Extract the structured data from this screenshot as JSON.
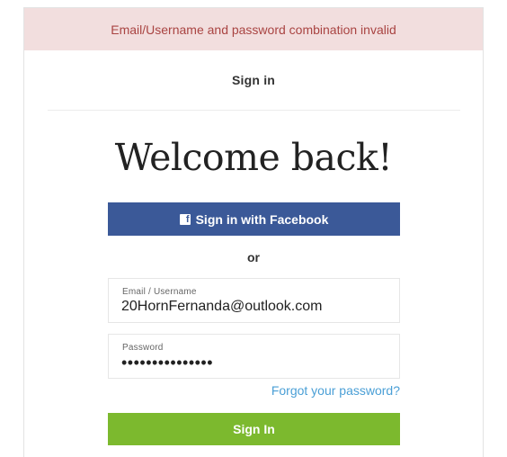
{
  "error": {
    "message": "Email/Username and password combination invalid"
  },
  "header": {
    "title": "Sign in"
  },
  "welcome": {
    "heading": "Welcome back!"
  },
  "facebook": {
    "label": "Sign in with Facebook",
    "icon": "facebook-icon",
    "icon_glyph": "f",
    "color": "#3b5998"
  },
  "separator": {
    "text": "or"
  },
  "email": {
    "label": "Email / Username",
    "value": "20HornFernanda@outlook.com"
  },
  "password": {
    "label": "Password",
    "value": "•••••••••••••••"
  },
  "forgot": {
    "label": "Forgot your password?"
  },
  "submit": {
    "label": "Sign In",
    "color": "#7cb92e"
  }
}
